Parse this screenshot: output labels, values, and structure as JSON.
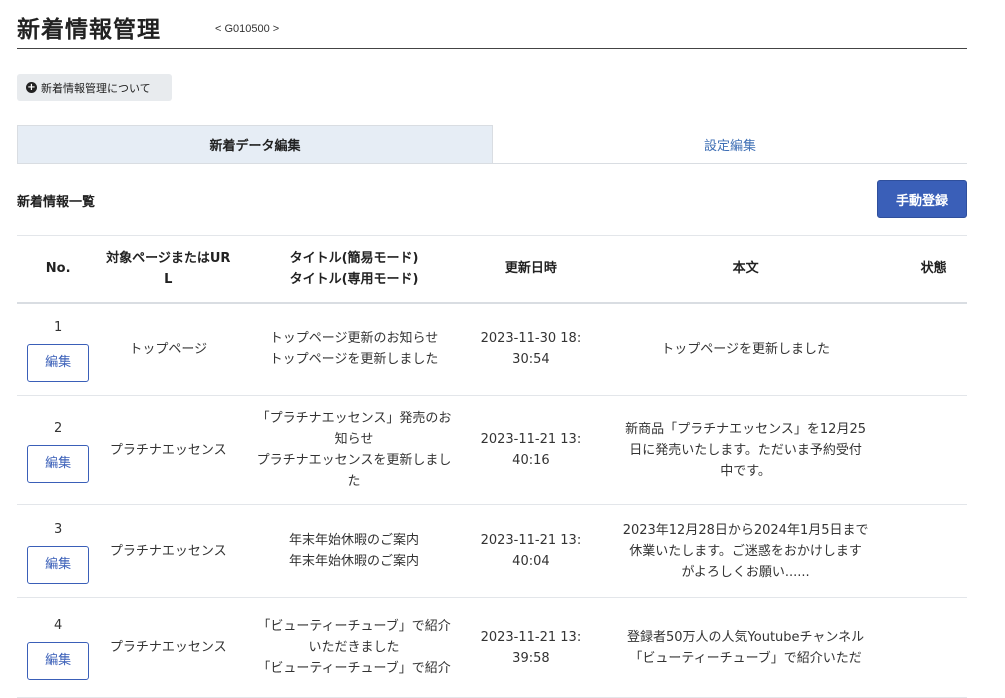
{
  "header": {
    "title": "新着情報管理",
    "screen_code": "< G010500 >"
  },
  "about_button": {
    "icon": "plus-circle-icon",
    "label": "新着情報管理について"
  },
  "tabs": [
    {
      "label": "新着データ編集",
      "active": true
    },
    {
      "label": "設定編集",
      "active": false
    }
  ],
  "list": {
    "title": "新着情報一覧",
    "manual_register_label": "手動登録"
  },
  "table": {
    "headers": {
      "no": "No.",
      "target_line1": "対象ページまたはUR",
      "target_line2": "L",
      "title_line1": "タイトル(簡易モード)",
      "title_line2": "タイトル(専用モード)",
      "updated": "更新日時",
      "body": "本文",
      "status": "状態"
    },
    "edit_label": "編集",
    "rows": [
      {
        "no": "1",
        "target": "トップページ",
        "title": "トップページ更新のお知らせ\nトップページを更新しました",
        "date1": "2023-11-30 18:",
        "date2": "30:54",
        "body": "トップページを更新しました",
        "status": ""
      },
      {
        "no": "2",
        "target": "プラチナエッセンス",
        "title": "「プラチナエッセンス」発売のお\n知らせ\nプラチナエッセンスを更新しまし\nた",
        "date1": "2023-11-21 13:",
        "date2": "40:16",
        "body": "新商品「プラチナエッセンス」を12月25\n日に発売いたします。ただいま予約受付\n中です。",
        "status": ""
      },
      {
        "no": "3",
        "target": "プラチナエッセンス",
        "title": "年末年始休暇のご案内\n年末年始休暇のご案内",
        "date1": "2023-11-21 13:",
        "date2": "40:04",
        "body": "2023年12月28日から2024年1月5日まで\n休業いたします。ご迷惑をおかけします\nがよろしくお願い......",
        "status": ""
      },
      {
        "no": "4",
        "target": "プラチナエッセンス",
        "title": "「ビューティーチューブ」で紹介\nいただきました\n「ビューティーチューブ」で紹介",
        "date1": "2023-11-21 13:",
        "date2": "39:58",
        "body": "登録者50万人の人気Youtubeチャンネル\n「ビューティーチューブ」で紹介いただ",
        "status": ""
      }
    ]
  }
}
